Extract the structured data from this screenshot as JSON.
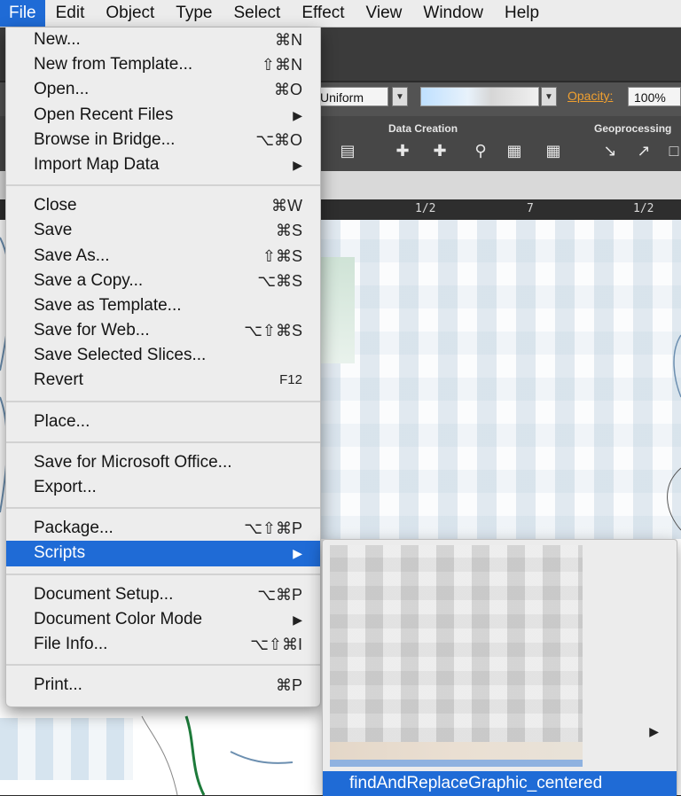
{
  "menubar": {
    "items": [
      "File",
      "Edit",
      "Object",
      "Type",
      "Select",
      "Effect",
      "View",
      "Window",
      "Help"
    ]
  },
  "toolbar": {
    "stroke_profile": "Uniform",
    "opacity_label": "Opacity:",
    "opacity_value": "100%",
    "data_creation_label": "Data Creation",
    "geoprocessing_label": "Geoprocessing"
  },
  "ruler": {
    "marks": [
      "1/2",
      "7",
      "1/2"
    ]
  },
  "file_menu": {
    "new": "New...",
    "new_sc": "⌘N",
    "new_template": "New from Template...",
    "new_template_sc": "⇧⌘N",
    "open": "Open...",
    "open_sc": "⌘O",
    "open_recent": "Open Recent Files",
    "browse": "Browse in Bridge...",
    "browse_sc": "⌥⌘O",
    "import_map": "Import Map Data",
    "close": "Close",
    "close_sc": "⌘W",
    "save": "Save",
    "save_sc": "⌘S",
    "save_as": "Save As...",
    "save_as_sc": "⇧⌘S",
    "save_copy": "Save a Copy...",
    "save_copy_sc": "⌥⌘S",
    "save_template": "Save as Template...",
    "save_web": "Save for Web...",
    "save_web_sc": "⌥⇧⌘S",
    "save_slices": "Save Selected Slices...",
    "revert": "Revert",
    "revert_sc": "F12",
    "place": "Place...",
    "save_office": "Save for Microsoft Office...",
    "export": "Export...",
    "package": "Package...",
    "package_sc": "⌥⇧⌘P",
    "scripts": "Scripts",
    "doc_setup": "Document Setup...",
    "doc_setup_sc": "⌥⌘P",
    "doc_color": "Document Color Mode",
    "file_info": "File Info...",
    "file_info_sc": "⌥⇧⌘I",
    "print": "Print...",
    "print_sc": "⌘P",
    "submenu_arrow": "▶"
  },
  "scripts_submenu": {
    "highlighted_item": "findAndReplaceGraphic_centered"
  },
  "colors": {
    "highlight": "#1f6bd6",
    "menu_bg": "#ededed",
    "opacity_link": "#f0a030"
  }
}
